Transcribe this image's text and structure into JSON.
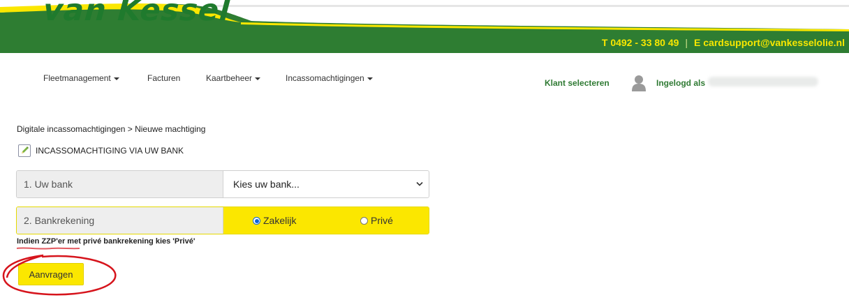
{
  "brand": {
    "logo_text": "van Kessel",
    "colors": {
      "green": "#2e7d32",
      "yellow": "#fbe700",
      "link_green": "#2f7a33",
      "annotation_red": "#d6141c"
    }
  },
  "header": {
    "phone": "T 0492 - 33 80 49",
    "separator": "|",
    "email": "E cardsupport@vankesselolie.nl"
  },
  "nav": {
    "items": [
      {
        "label": "Fleetmanagement",
        "dropdown": true
      },
      {
        "label": "Facturen",
        "dropdown": false
      },
      {
        "label": "Kaartbeheer",
        "dropdown": true
      },
      {
        "label": "Incassomachtigingen",
        "dropdown": true
      }
    ],
    "select_client": "Klant selecteren",
    "logged_in_label": "Ingelogd als",
    "user_icon": "user-icon"
  },
  "page": {
    "breadcrumb": "Digitale incassomachtigingen > Nieuwe machtiging",
    "section_title": "INCASSOMACHTIGING VIA UW BANK",
    "section_icon": "edit-icon",
    "bank": {
      "label": "1. Uw bank",
      "selected_value": "Kies uw bank..."
    },
    "account": {
      "label": "2. Bankrekening",
      "options": [
        {
          "label": "Zakelijk",
          "checked": true
        },
        {
          "label": "Privé",
          "checked": false
        }
      ]
    },
    "note": "Indien ZZP'er met privé bankrekening kies 'Privé'",
    "submit_label": "Aanvragen"
  }
}
